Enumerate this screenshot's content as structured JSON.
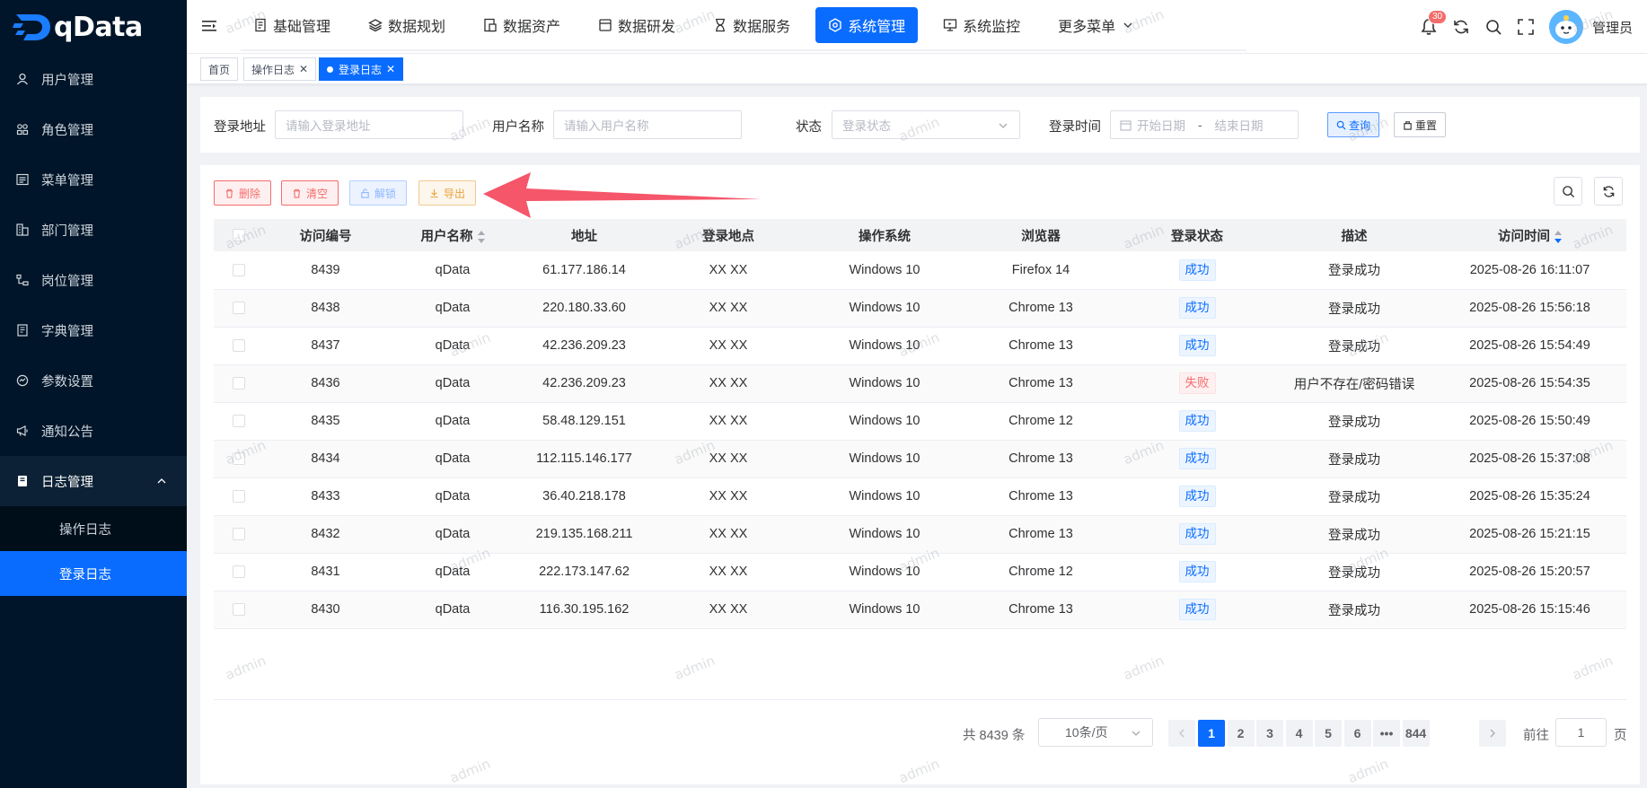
{
  "app": {
    "logo_text": "qData"
  },
  "sidebar": {
    "items": [
      {
        "label": "用户管理",
        "icon": "user-icon"
      },
      {
        "label": "角色管理",
        "icon": "roles-icon"
      },
      {
        "label": "菜单管理",
        "icon": "menu-list-icon"
      },
      {
        "label": "部门管理",
        "icon": "department-icon"
      },
      {
        "label": "岗位管理",
        "icon": "post-icon"
      },
      {
        "label": "字典管理",
        "icon": "dictionary-icon"
      },
      {
        "label": "参数设置",
        "icon": "settings-icon"
      },
      {
        "label": "通知公告",
        "icon": "megaphone-icon"
      },
      {
        "label": "日志管理",
        "icon": "log-icon"
      }
    ],
    "sub_items": [
      {
        "label": "操作日志"
      },
      {
        "label": "登录日志"
      }
    ]
  },
  "topnav": {
    "items": [
      {
        "label": "基础管理",
        "icon": "document-icon"
      },
      {
        "label": "数据规划",
        "icon": "layers-icon"
      },
      {
        "label": "数据资产",
        "icon": "asset-icon"
      },
      {
        "label": "数据研发",
        "icon": "database-icon"
      },
      {
        "label": "数据服务",
        "icon": "hourglass-icon"
      },
      {
        "label": "系统管理",
        "icon": "gear-icon"
      },
      {
        "label": "系统监控",
        "icon": "monitor-icon"
      },
      {
        "label": "更多菜单",
        "icon": "chevron-down-icon"
      }
    ],
    "notification_count": "30",
    "username": "管理员"
  },
  "tabs": [
    {
      "label": "首页"
    },
    {
      "label": "操作日志"
    },
    {
      "label": "登录日志"
    }
  ],
  "search": {
    "ipaddr_label": "登录地址",
    "ipaddr_placeholder": "请输入登录地址",
    "username_label": "用户名称",
    "username_placeholder": "请输入用户名称",
    "status_label": "状态",
    "status_placeholder": "登录状态",
    "time_label": "登录时间",
    "start_placeholder": "开始日期",
    "range_sep": "-",
    "end_placeholder": "结束日期",
    "query_label": "查询",
    "reset_label": "重置"
  },
  "actions": {
    "delete_label": "删除",
    "clear_label": "清空",
    "unlock_label": "解锁",
    "export_label": "导出"
  },
  "table": {
    "columns": [
      "访问编号",
      "用户名称",
      "地址",
      "登录地点",
      "操作系统",
      "浏览器",
      "登录状态",
      "描述",
      "访问时间"
    ],
    "rows": [
      [
        "8439",
        "qData",
        "61.177.186.14",
        "XX XX",
        "Windows 10",
        "Firefox 14",
        "成功",
        "登录成功",
        "2025-08-26 16:11:07"
      ],
      [
        "8438",
        "qData",
        "220.180.33.60",
        "XX XX",
        "Windows 10",
        "Chrome 13",
        "成功",
        "登录成功",
        "2025-08-26 15:56:18"
      ],
      [
        "8437",
        "qData",
        "42.236.209.23",
        "XX XX",
        "Windows 10",
        "Chrome 13",
        "成功",
        "登录成功",
        "2025-08-26 15:54:49"
      ],
      [
        "8436",
        "qData",
        "42.236.209.23",
        "XX XX",
        "Windows 10",
        "Chrome 13",
        "失败",
        "用户不存在/密码错误",
        "2025-08-26 15:54:35"
      ],
      [
        "8435",
        "qData",
        "58.48.129.151",
        "XX XX",
        "Windows 10",
        "Chrome 12",
        "成功",
        "登录成功",
        "2025-08-26 15:50:49"
      ],
      [
        "8434",
        "qData",
        "112.115.146.177",
        "XX XX",
        "Windows 10",
        "Chrome 13",
        "成功",
        "登录成功",
        "2025-08-26 15:37:08"
      ],
      [
        "8433",
        "qData",
        "36.40.218.178",
        "XX XX",
        "Windows 10",
        "Chrome 13",
        "成功",
        "登录成功",
        "2025-08-26 15:35:24"
      ],
      [
        "8432",
        "qData",
        "219.135.168.211",
        "XX XX",
        "Windows 10",
        "Chrome 13",
        "成功",
        "登录成功",
        "2025-08-26 15:21:15"
      ],
      [
        "8431",
        "qData",
        "222.173.147.62",
        "XX XX",
        "Windows 10",
        "Chrome 12",
        "成功",
        "登录成功",
        "2025-08-26 15:20:57"
      ],
      [
        "8430",
        "qData",
        "116.30.195.162",
        "XX XX",
        "Windows 10",
        "Chrome 13",
        "成功",
        "登录成功",
        "2025-08-26 15:15:46"
      ]
    ]
  },
  "pagination": {
    "total_text": "共 8439 条",
    "page_size": "10条/页",
    "pages": [
      "1",
      "2",
      "3",
      "4",
      "5",
      "6",
      "•••",
      "844"
    ],
    "current_page": "1",
    "goto_label": "前往",
    "goto_value": "1",
    "page_suffix": "页"
  },
  "watermark": "admin",
  "colors": {
    "primary": "#0a6cff",
    "sidebar_bg": "#001529",
    "danger": "#f56c6c",
    "warning": "#e6a23c",
    "annotation_arrow": "#f5566a"
  }
}
